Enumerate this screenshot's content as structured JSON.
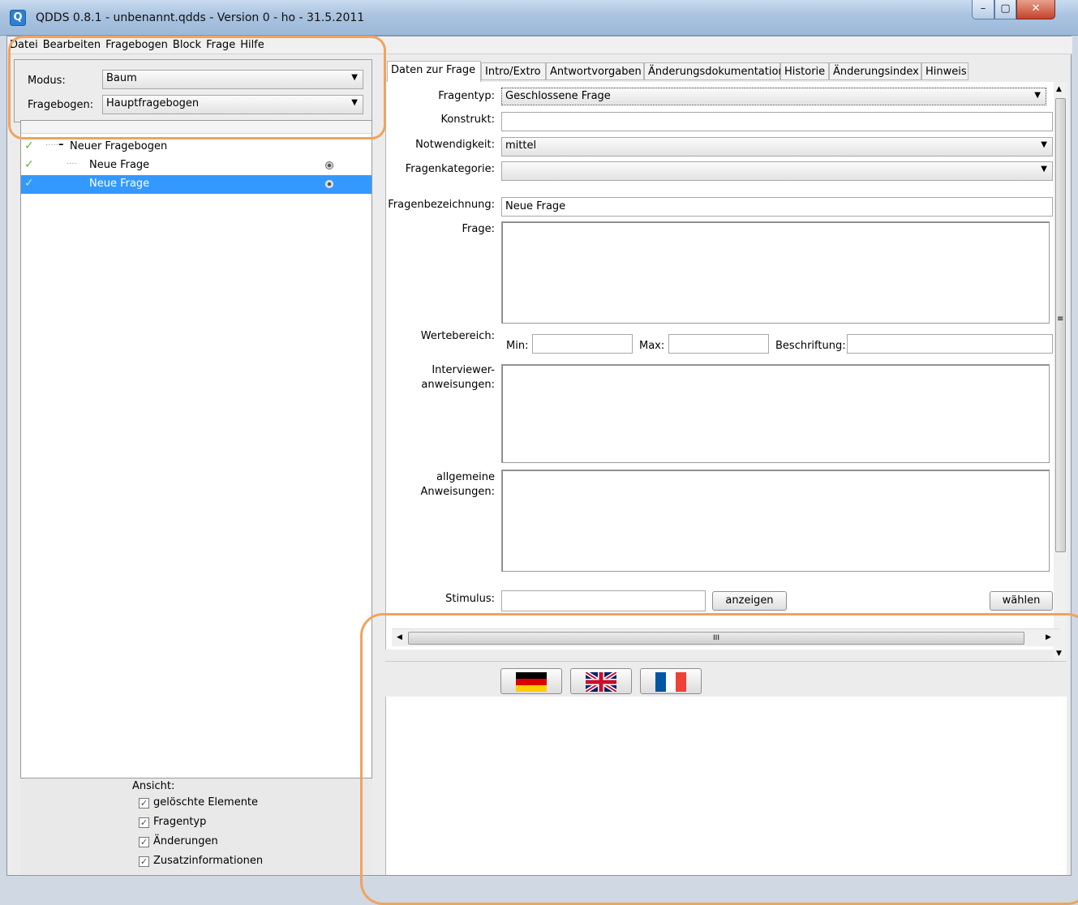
{
  "window": {
    "title": "QDDS 0.8.1 - unbenannt.qdds - Version 0 - ho - 31.5.2011",
    "app_icon": "Q"
  },
  "menu": [
    "Datei",
    "Bearbeiten",
    "Fragebogen",
    "Block",
    "Frage",
    "Hilfe"
  ],
  "left": {
    "modus_label": "Modus:",
    "modus_value": "Baum",
    "fragebogen_label": "Fragebogen:",
    "fragebogen_value": "Hauptfragebogen",
    "tree": [
      {
        "label": "Neuer Fragebogen"
      },
      {
        "label": "Neue Frage"
      },
      {
        "label": "Neue Frage",
        "selected": true
      }
    ],
    "view": {
      "title": "Ansicht:",
      "options": [
        "gelöschte Elemente",
        "Fragentyp",
        "Änderungen",
        "Zusatzinformationen"
      ]
    }
  },
  "tabs": [
    "Daten zur Frage",
    "Intro/Extro",
    "Antwortvorgaben",
    "Änderungsdokumentation",
    "Historie",
    "Änderungsindex",
    "Hinweis"
  ],
  "form": {
    "fragentyp_label": "Fragentyp:",
    "fragentyp_value": "Geschlossene Frage",
    "konstrukt_label": "Konstrukt:",
    "konstrukt_value": "",
    "notwendigkeit_label": "Notwendigkeit:",
    "notwendigkeit_value": "mittel",
    "fragenkategorie_label": "Fragenkategorie:",
    "fragenkategorie_value": "",
    "bezeichnung_label": "Fragenbezeichnung:",
    "bezeichnung_value": "Neue Frage",
    "frage_label": "Frage:",
    "wertebereich_label": "Wertebereich:",
    "min_label": "Min:",
    "max_label": "Max:",
    "beschriftung_label": "Beschriftung:",
    "interviewer_label_1": "Interviewer-",
    "interviewer_label_2": "anweisungen:",
    "allgemeine_label_1": "allgemeine",
    "allgemeine_label_2": "Anweisungen:",
    "stimulus_label": "Stimulus:",
    "anzeigen": "anzeigen",
    "waehlen": "wählen"
  },
  "scroll": {
    "hscroll_grip": "III",
    "vscroll_grip": "≡"
  },
  "flags": [
    "de-flag-icon",
    "uk-flag-icon",
    "fr-flag-icon"
  ],
  "colors": {
    "selection": "#3399ff",
    "annotation": "#f0a35e",
    "check": "#5cb536"
  }
}
